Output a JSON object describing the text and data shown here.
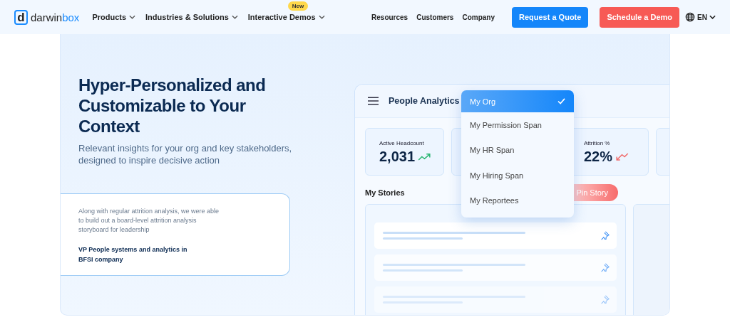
{
  "nav": {
    "logo": {
      "mark": "d",
      "text": "darwin",
      "accent": "box"
    },
    "menus": [
      {
        "label": "Products"
      },
      {
        "label": "Industries & Solutions"
      },
      {
        "label": "Interactive Demos",
        "badge": "New"
      }
    ],
    "links": [
      "Resources",
      "Customers",
      "Company"
    ],
    "buttons": [
      {
        "label": "Request a Quote",
        "kind": "primary"
      },
      {
        "label": "Schedule a Demo",
        "kind": "accent"
      }
    ],
    "language": "EN"
  },
  "hero": {
    "title": "Hyper-Personalized and Customizable to Your Context",
    "subtitle": "Relevant insights for your org and key stakeholders, designed to inspire decisive action",
    "testimonial": {
      "quote": "Along with regular attrition analysis, we were able to build out a board-level attrition analysis storyboard for leadership",
      "author": "VP People systems and analytics in BFSI company"
    }
  },
  "mockup": {
    "title": "People Analytics",
    "stats": [
      {
        "kind": "rising",
        "label": "Active Headcount",
        "value": "2,031"
      },
      {
        "kind": "covered"
      },
      {
        "kind": "falling",
        "label": "Attrition %",
        "value": "22%"
      },
      {
        "kind": "covered"
      }
    ],
    "stories_title": "My Stories",
    "pin_button": "Pin Story",
    "dropdown": [
      {
        "label": "My Org",
        "selected": true
      },
      {
        "label": "My Permission Span",
        "selected": false
      },
      {
        "label": "My HR Span",
        "selected": false
      },
      {
        "label": "My Hiring Span",
        "selected": false
      },
      {
        "label": "My Reportees",
        "selected": false
      }
    ]
  }
}
